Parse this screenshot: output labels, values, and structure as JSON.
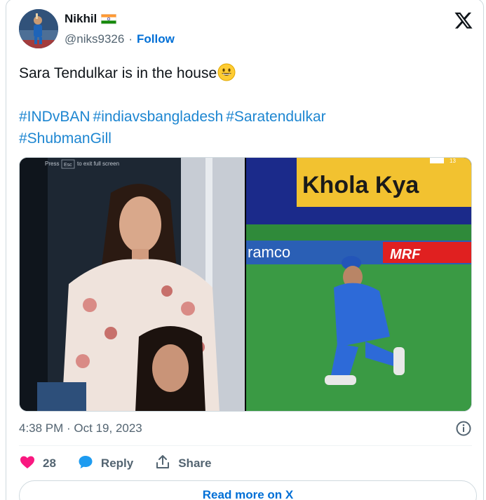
{
  "author": {
    "name": "Nikhil",
    "handle": "@niks9326",
    "separator": "·",
    "follow_label": "Follow"
  },
  "tweet": {
    "text": "Sara Tendulkar is in the house",
    "emoji": "grinning-face",
    "hashtags_line1": [
      "#INDvBAN",
      "#indiavsbangladesh",
      "#Saratendulkar"
    ],
    "hashtags_line2": [
      "#ShubmanGill"
    ]
  },
  "media": {
    "left_overlay": {
      "press": "Press",
      "key": "Esc",
      "exit": "to exit full screen"
    },
    "right_overlay": {
      "banner": "Khola Kya",
      "sponsor": "ramco",
      "mrf": "MRF",
      "tag": "13"
    }
  },
  "meta": {
    "timestamp": "4:38 PM · Oct 19, 2023"
  },
  "actions": {
    "likes": "28",
    "reply_label": "Reply",
    "share_label": "Share"
  },
  "read_more_label": "Read more on X",
  "colors": {
    "link": "#006fd6",
    "hashtag": "#1d86d1",
    "like": "#f91880",
    "muted": "#536471",
    "border": "#cfd9de"
  },
  "icons": [
    "x-logo-icon",
    "india-flag-icon",
    "info-icon",
    "heart-icon",
    "reply-bubble-icon",
    "share-icon",
    "grinning-face-emoji"
  ]
}
